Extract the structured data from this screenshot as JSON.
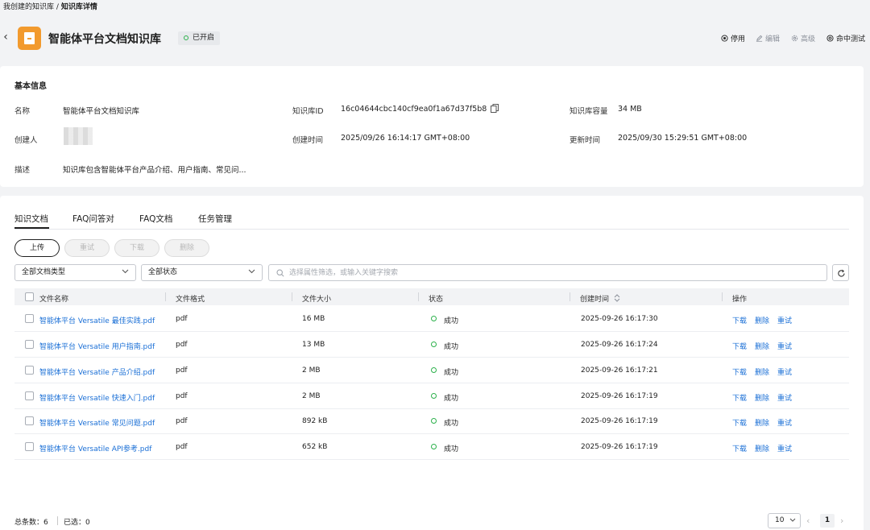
{
  "breadcrumb": {
    "parent": "我创建的知识库",
    "separator": "/",
    "current": "知识库详情"
  },
  "header": {
    "title": "智能体平台文档知识库",
    "status": "已开启",
    "actions": {
      "disable": "停用",
      "edit": "编辑",
      "advanced": "高级",
      "hit_test": "命中测试"
    }
  },
  "info": {
    "section_title": "基本信息",
    "name_label": "名称",
    "name_value": "智能体平台文档知识库",
    "id_label": "知识库ID",
    "id_value": "16c04644cbc140cf9ea0f1a67d37f5b8",
    "capacity_label": "知识库容量",
    "capacity_value": "34 MB",
    "creator_label": "创建人",
    "created_label": "创建时间",
    "created_value": "2025/09/26 16:14:17 GMT+08:00",
    "updated_label": "更新时间",
    "updated_value": "2025/09/30 15:29:51 GMT+08:00",
    "desc_label": "描述",
    "desc_value": "知识库包含智能体平台产品介绍、用户指南、常见问..."
  },
  "tabs": [
    "知识文档",
    "FAQ问答对",
    "FAQ文档",
    "任务管理"
  ],
  "toolbar": {
    "upload": "上传",
    "retry": "重试",
    "download": "下载",
    "delete": "删除"
  },
  "filters": {
    "doc_type": "全部文档类型",
    "status": "全部状态",
    "search_placeholder": "选择属性筛选，或输入关键字搜索"
  },
  "table": {
    "headers": {
      "name": "文件名称",
      "format": "文件格式",
      "size": "文件大小",
      "status": "状态",
      "created": "创建时间",
      "ops": "操作"
    },
    "rows": [
      {
        "name": "智能体平台 Versatile 最佳实践.pdf",
        "format": "pdf",
        "size": "16 MB",
        "status": "成功",
        "created": "2025-09-26 16:17:30"
      },
      {
        "name": "智能体平台 Versatile 用户指南.pdf",
        "format": "pdf",
        "size": "13 MB",
        "status": "成功",
        "created": "2025-09-26 16:17:24"
      },
      {
        "name": "智能体平台 Versatile 产品介绍.pdf",
        "format": "pdf",
        "size": "2 MB",
        "status": "成功",
        "created": "2025-09-26 16:17:21"
      },
      {
        "name": "智能体平台 Versatile 快速入门.pdf",
        "format": "pdf",
        "size": "2 MB",
        "status": "成功",
        "created": "2025-09-26 16:17:19"
      },
      {
        "name": "智能体平台 Versatile 常见问题.pdf",
        "format": "pdf",
        "size": "892 kB",
        "status": "成功",
        "created": "2025-09-26 16:17:19"
      },
      {
        "name": "智能体平台 Versatile API参考.pdf",
        "format": "pdf",
        "size": "652 kB",
        "status": "成功",
        "created": "2025-09-26 16:17:19"
      }
    ],
    "ops": {
      "download": "下载",
      "delete": "删除",
      "retry": "重试"
    }
  },
  "footer": {
    "total": "总条数：6",
    "selected": "已选：0",
    "page_size": "10",
    "page": "1"
  },
  "colors": {
    "accent": "#1a6fd6",
    "success": "#2cb14b",
    "icon_orange": "#f29a2e"
  }
}
